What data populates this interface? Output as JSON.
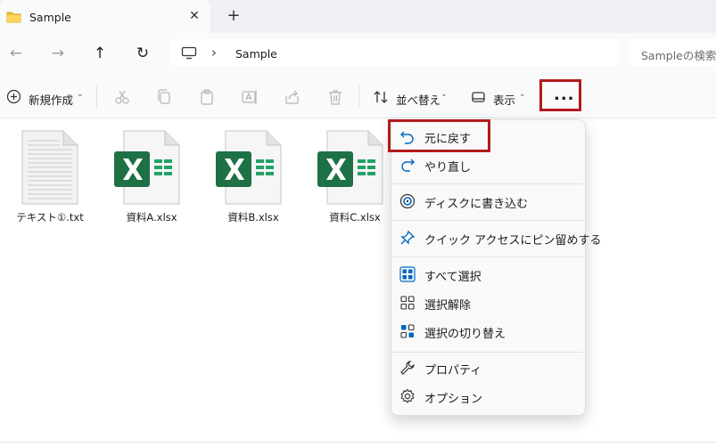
{
  "tab": {
    "title": "Sample",
    "close": "✕",
    "new": "+"
  },
  "nav": {
    "back": "←",
    "forward": "→",
    "up": "↑",
    "refresh": "↻",
    "chevron": "›",
    "breadcrumb": "Sample",
    "search_placeholder": "Sampleの検索"
  },
  "commands": {
    "new_label": "新規作成",
    "sort_label": "並べ替え",
    "view_label": "表示",
    "more_label": "..."
  },
  "files": [
    {
      "name": "テキスト①.txt",
      "type": "txt"
    },
    {
      "name": "資料A.xlsx",
      "type": "xlsx"
    },
    {
      "name": "資料B.xlsx",
      "type": "xlsx"
    },
    {
      "name": "資料C.xlsx",
      "type": "xlsx"
    }
  ],
  "menu": {
    "items": [
      {
        "label": "元に戻す",
        "icon": "undo-icon"
      },
      {
        "label": "やり直し",
        "icon": "redo-icon"
      },
      {
        "label": "ディスクに書き込む",
        "icon": "disc-icon"
      },
      {
        "label": "クイック アクセスにピン留めする",
        "icon": "pin-icon"
      },
      {
        "label": "すべて選択",
        "icon": "select-all-icon"
      },
      {
        "label": "選択解除",
        "icon": "select-none-icon"
      },
      {
        "label": "選択の切り替え",
        "icon": "invert-selection-icon"
      },
      {
        "label": "プロパティ",
        "icon": "properties-icon"
      },
      {
        "label": "オプション",
        "icon": "options-icon"
      }
    ]
  },
  "colors": {
    "accent": "#0067c0",
    "excel_green": "#1d7145",
    "highlight": "#b31b1b"
  }
}
